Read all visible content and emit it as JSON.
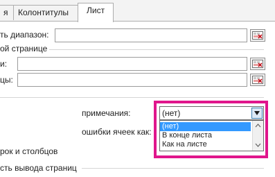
{
  "tabs": [
    {
      "label": "я"
    },
    {
      "label": "Колонтитулы"
    },
    {
      "label": "Лист"
    }
  ],
  "fields": {
    "print_area_label": "ть диапазон:",
    "print_titles_label": "ой странице",
    "rows_label": "и:",
    "cols_label": "цы:"
  },
  "print_section": {
    "comments_label": "примечания:",
    "cell_errors_label": "ошибки ячеек как:",
    "headings_label": "рок и столбцов",
    "page_order_label": "сть вывода страниц",
    "comments_combo": {
      "selected": "(нет)",
      "options": [
        "(нет)",
        "В конце листа",
        "Как на листе"
      ]
    }
  },
  "colors": {
    "highlight": "#e0168c",
    "selection": "#3399ff"
  },
  "icons": {
    "range_button": "collapse-dialog-icon",
    "dropdown": "chevron-down-icon"
  }
}
